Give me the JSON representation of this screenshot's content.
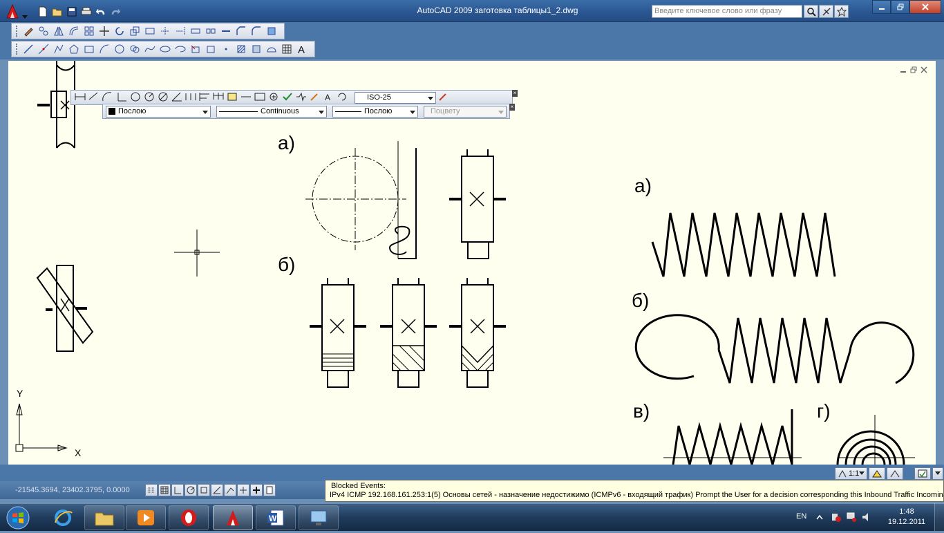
{
  "window": {
    "title": "AutoCAD 2009 заготовка таблицы1_2.dwg",
    "search_placeholder": "Введите ключевое слово или фразу"
  },
  "toolbars": {
    "float_dim_style": "ISO-25",
    "layer_color": "Послою",
    "linetype": "Continuous",
    "lineweight": "Послою",
    "plot_style": "Поцвету"
  },
  "drawing": {
    "labels": {
      "a1": "а)",
      "b1": "б)",
      "a2": "а)",
      "b2": "б)",
      "v2": "в)",
      "g2": "г)"
    },
    "ucs": {
      "x": "X",
      "y": "Y"
    }
  },
  "status": {
    "coordinates": "-21545.3694, 23402.3795, 0.0000",
    "annotation_scale": "1:1"
  },
  "balloon": {
    "title": "Blocked Events:",
    "message": "IPv4 ICMP 192.168.161.253:1(5) Основы сетей - назначение недостижимо (ICMPv6 - входящий трафик) Prompt the User for a decision corresponding this Inbound Traffic Incoming"
  },
  "taskbar": {
    "language": "EN",
    "time": "1:48",
    "date": "19.12.2011"
  },
  "colors": {
    "canvas": "#fffff0",
    "chrome": "#4a76a8",
    "balloon": "#ffffe1"
  }
}
